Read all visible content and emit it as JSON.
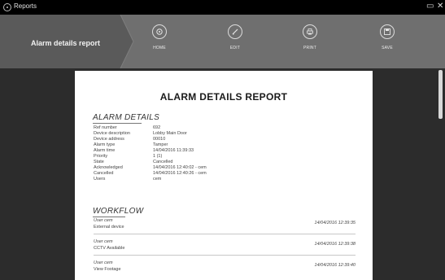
{
  "window": {
    "title": "Reports",
    "minimize_glyph": "▭",
    "close_glyph": "✕"
  },
  "toolbar": {
    "breadcrumb": "Alarm details report",
    "buttons": [
      {
        "label": "HOME",
        "icon": "home-icon"
      },
      {
        "label": "EDIT",
        "icon": "edit-icon"
      },
      {
        "label": "PRINT",
        "icon": "print-icon"
      },
      {
        "label": "SAVE",
        "icon": "save-icon"
      }
    ]
  },
  "report": {
    "title": "ALARM DETAILS REPORT",
    "details_heading": "ALARM DETAILS",
    "details": [
      {
        "key": "Ref number",
        "value": "692"
      },
      {
        "key": "Device description",
        "value": "Lobby Main Door"
      },
      {
        "key": "Device address",
        "value": "00010"
      },
      {
        "key": "Alarm type",
        "value": "Tamper"
      },
      {
        "key": "Alarm time",
        "value": "14/04/2016 11:39:33"
      },
      {
        "key": "Priority",
        "value": "1 (1)"
      },
      {
        "key": "State",
        "value": "Cancelled"
      },
      {
        "key": "Acknowledged",
        "value": "14/04/2016 12:40:02 - cem"
      },
      {
        "key": "Cancelled",
        "value": "14/04/2016 12:40:26 - cem"
      },
      {
        "key": "Users",
        "value": "cem"
      }
    ],
    "workflow_heading": "WORKFLOW",
    "workflow": [
      {
        "user": "User cem",
        "action": "External device",
        "time": "14/04/2016 12:39:35"
      },
      {
        "user": "User cem",
        "action": "CCTV Available",
        "time": "14/04/2016 12:39:38"
      },
      {
        "user": "User cem",
        "action": "View Footage",
        "time": "14/04/2016 12:39:40"
      }
    ]
  },
  "colors": {
    "toolbar": "#6f6f6f",
    "breadcrumb": "#5a5a5a",
    "workspace": "#2c2c2c",
    "titlebar": "#000000"
  }
}
